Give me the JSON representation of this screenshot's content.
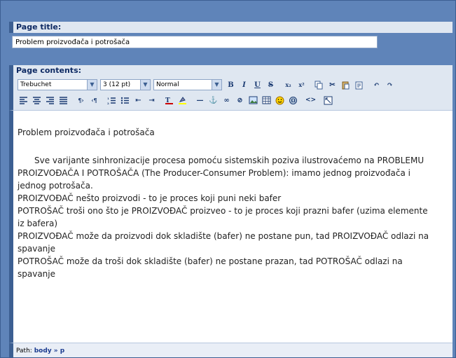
{
  "page_title_label": "Page title:",
  "page_title_value": "Problem proizvođača i potrošača",
  "page_contents_label": "Page contents:",
  "toolbar": {
    "font_family": "Trebuchet",
    "font_size": "3 (12 pt)",
    "format": "Normal",
    "bold_icon": "bold-icon",
    "italic_icon": "italic-icon",
    "underline_icon": "underline-icon",
    "strike_icon": "strikethrough-icon"
  },
  "editor": {
    "heading": "Problem proizvođača i potrošača",
    "paragraph": "Sve varijante sinhronizacije procesa pomoću sistemskih poziva ilustrovaćemo na PROBLEMU PROIZVOĐAČA I POTROŠAČA (The Producer-Consumer Problem): imamo jednog proizvođača i jednog potrošača.",
    "line1": "PROIZVOĐAČ nešto proizvodi - to je proces koji puni neki bafer",
    "line2": "POTROŠAČ troši ono što je PROIZVOĐAČ proizveo - to je proces koji prazni bafer (uzima elemente iz bafera)",
    "line3": "PROIZVOĐAČ može da proizvodi dok skladište (bafer) ne postane pun, tad PROIZVOĐAČ odlazi na spavanje",
    "line4": "POTROŠAČ može da troši dok skladište (bafer) ne postane prazan, tad POTROŠAČ odlazi na spavanje"
  },
  "path": {
    "label": "Path:",
    "value": "body » p"
  },
  "colors": {
    "frame": "#5f84b9",
    "header_bg": "#dfe7f1",
    "label": "#0e2a63"
  }
}
